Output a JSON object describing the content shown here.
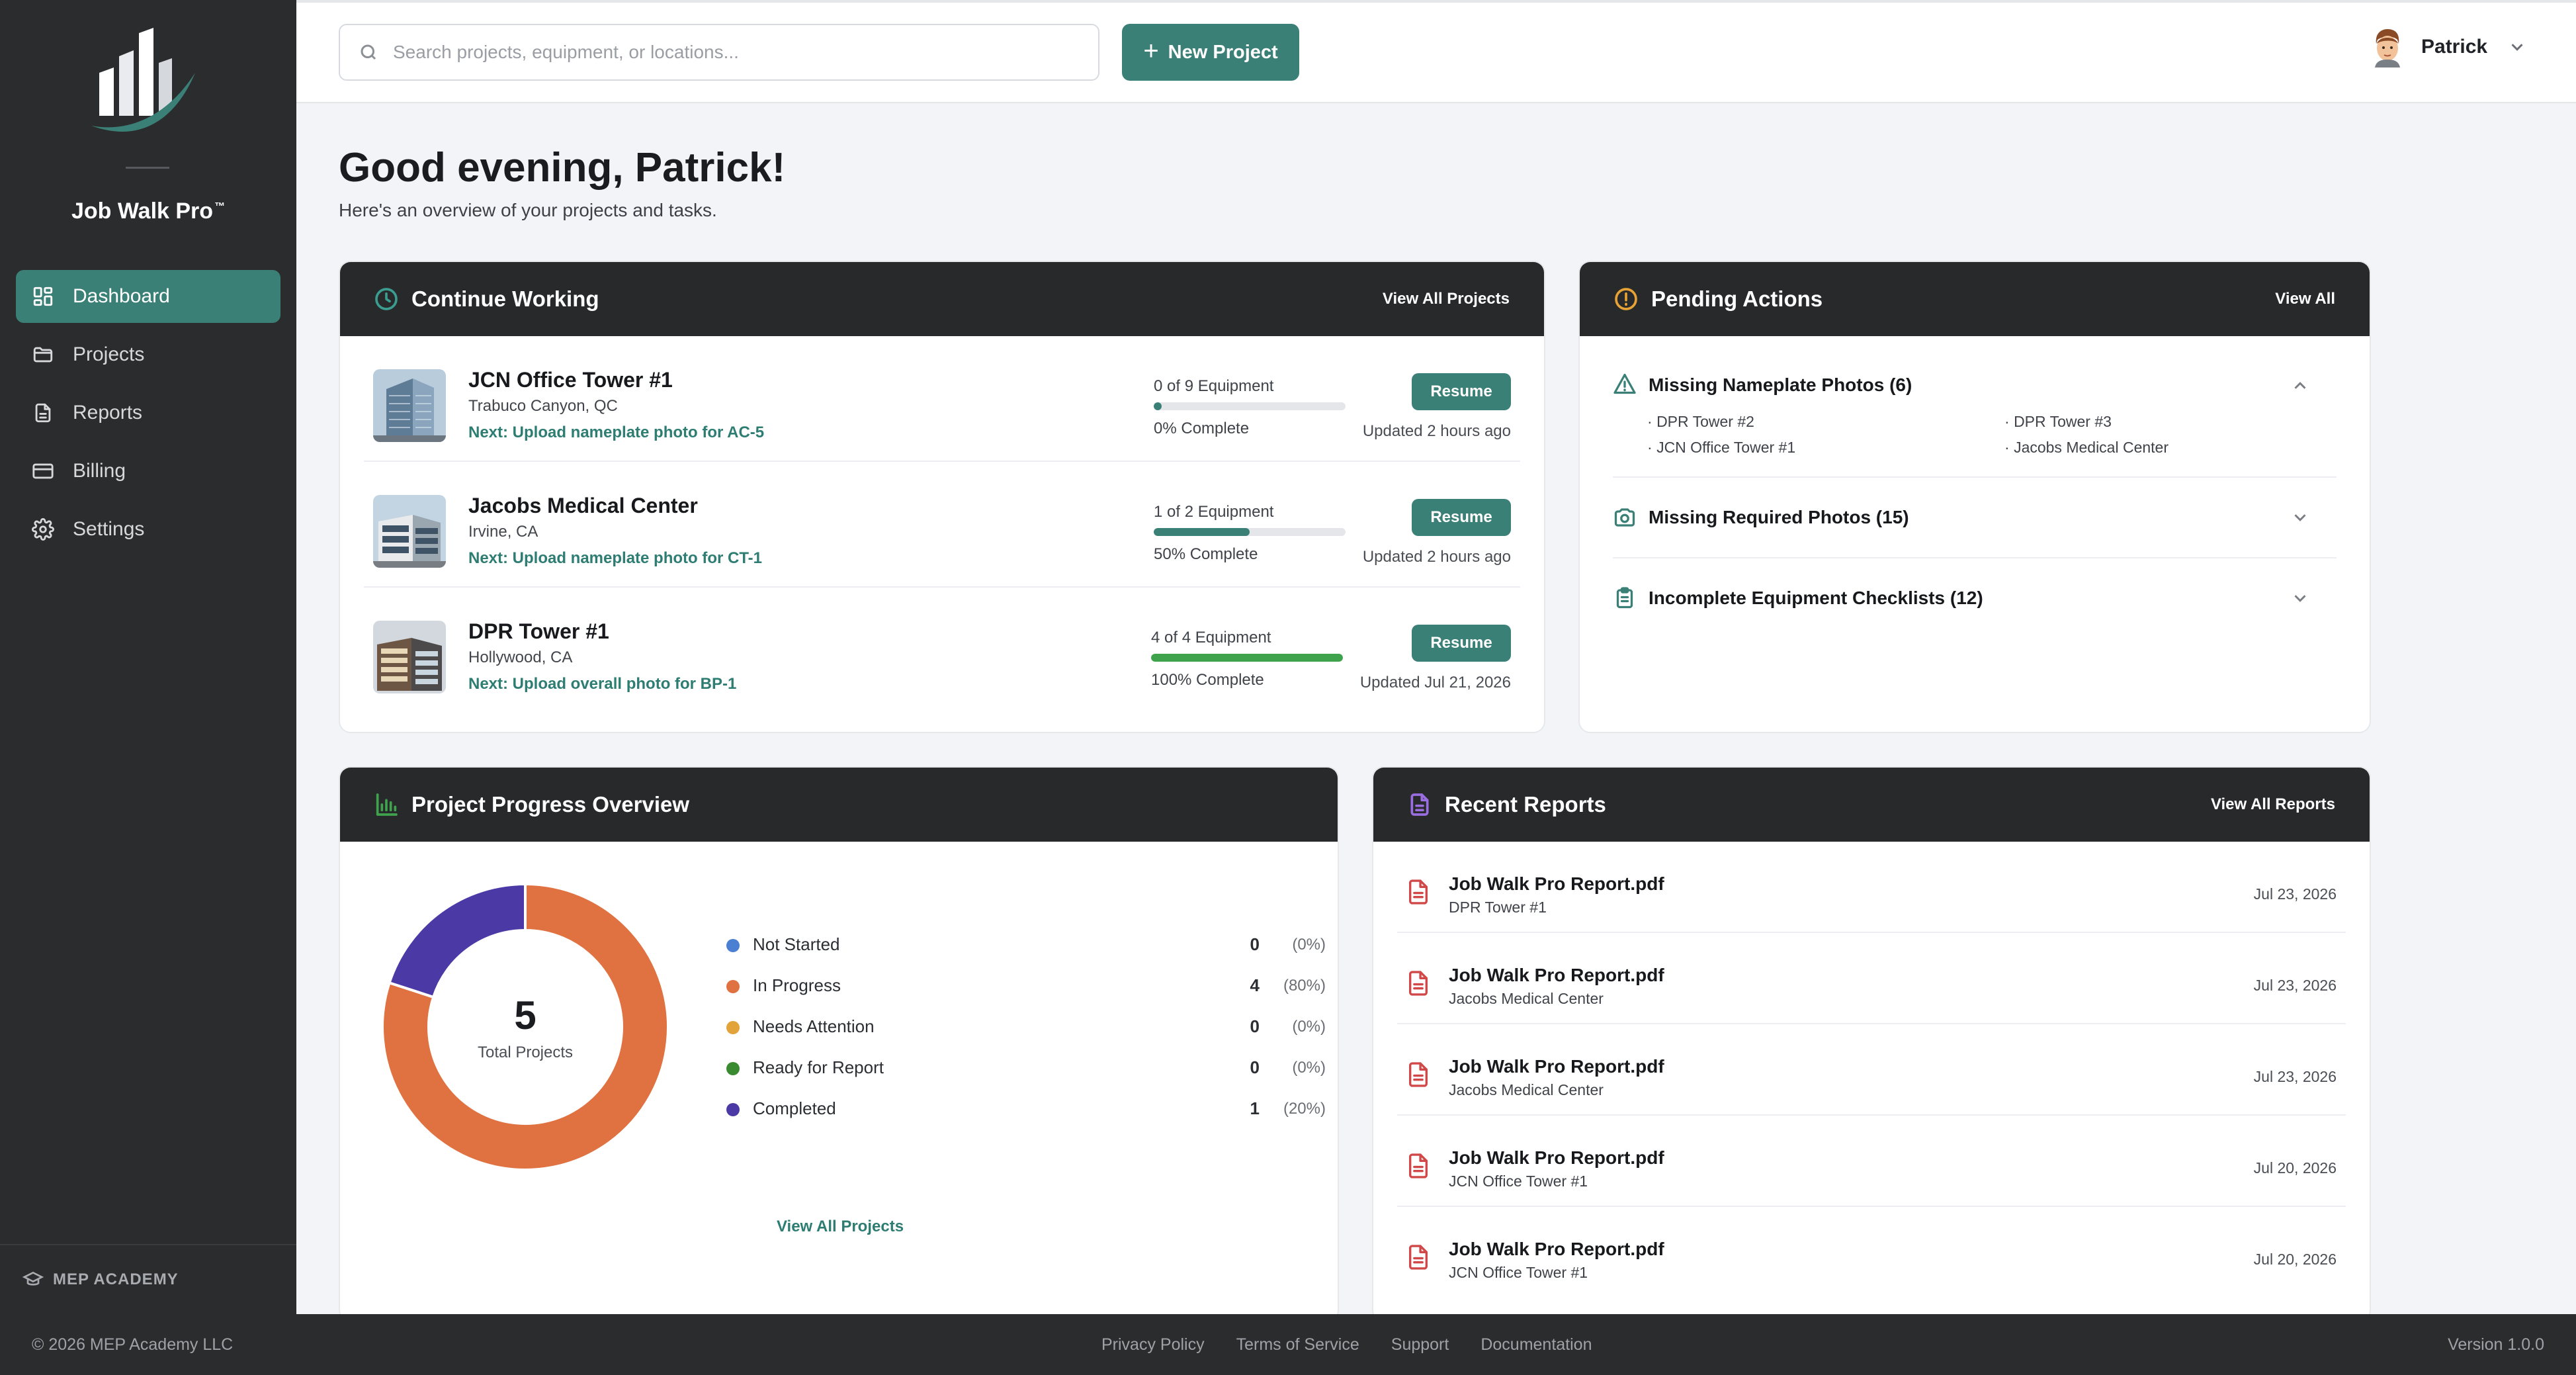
{
  "sidebar": {
    "brand": "Job Walk Pro",
    "brand_mark": "™",
    "nav": [
      {
        "label": "Dashboard",
        "icon": "dashboard-icon",
        "active": true
      },
      {
        "label": "Projects",
        "icon": "folder-icon"
      },
      {
        "label": "Reports",
        "icon": "document-icon"
      },
      {
        "label": "Billing",
        "icon": "credit-card-icon"
      },
      {
        "label": "Settings",
        "icon": "gear-icon"
      }
    ],
    "academy": "MEP ACADEMY"
  },
  "topbar": {
    "search_placeholder": "Search projects, equipment, or locations...",
    "new_project": "New Project",
    "user_name": "Patrick"
  },
  "greeting": {
    "title": "Good evening, Patrick!",
    "subtitle": "Here's an overview of your projects and tasks."
  },
  "continue_working": {
    "title": "Continue Working",
    "link": "View All Projects",
    "projects": [
      {
        "name": "JCN Office Tower #1",
        "location": "Trabuco Canyon, QC",
        "next": "Next: Upload nameplate photo for AC-5",
        "equipment": "0 of 9 Equipment",
        "progress": 0,
        "percent_label": "0% Complete",
        "button": "Resume",
        "updated": "Updated 2 hours ago"
      },
      {
        "name": "Jacobs Medical Center",
        "location": "Irvine, CA",
        "next": "Next: Upload nameplate photo for CT-1",
        "equipment": "1 of 2 Equipment",
        "progress": 50,
        "percent_label": "50% Complete",
        "button": "Resume",
        "updated": "Updated 2 hours ago"
      },
      {
        "name": "DPR Tower #1",
        "location": "Hollywood, CA",
        "next": "Next: Upload overall photo for BP-1",
        "equipment": "4 of 4 Equipment",
        "progress": 100,
        "percent_label": "100% Complete",
        "button": "Resume",
        "updated": "Updated Jul 21, 2026"
      }
    ]
  },
  "pending_actions": {
    "title": "Pending Actions",
    "link": "View All",
    "sections": [
      {
        "title": "Missing Nameplate Photos (6)",
        "icon": "warning-triangle-icon",
        "expanded": true,
        "items": [
          "DPR Tower #2",
          "DPR Tower #3",
          "JCN Office Tower #1",
          "Jacobs Medical Center"
        ]
      },
      {
        "title": "Missing Required Photos (15)",
        "icon": "camera-icon",
        "expanded": false
      },
      {
        "title": "Incomplete Equipment Checklists (12)",
        "icon": "clipboard-icon",
        "expanded": false
      }
    ]
  },
  "progress_overview": {
    "title": "Project Progress Overview",
    "total": "5",
    "total_label": "Total Projects",
    "link": "View All Projects",
    "legend": [
      {
        "label": "Not Started",
        "count": "0",
        "pct": "(0%)",
        "color": "#4a7fd1"
      },
      {
        "label": "In Progress",
        "count": "4",
        "pct": "(80%)",
        "color": "#e07140"
      },
      {
        "label": "Needs Attention",
        "count": "0",
        "pct": "(0%)",
        "color": "#e3a33b"
      },
      {
        "label": "Ready for Report",
        "count": "0",
        "pct": "(0%)",
        "color": "#3a8a32"
      },
      {
        "label": "Completed",
        "count": "1",
        "pct": "(20%)",
        "color": "#4b3aa6"
      }
    ]
  },
  "chart_data": {
    "type": "pie",
    "categories": [
      "Not Started",
      "In Progress",
      "Needs Attention",
      "Ready for Report",
      "Completed"
    ],
    "values": [
      0,
      4,
      0,
      0,
      1
    ],
    "colors": [
      "#4a7fd1",
      "#e07140",
      "#e3a33b",
      "#3a8a32",
      "#4b3aa6"
    ],
    "title": "Project Progress Overview"
  },
  "recent_reports": {
    "title": "Recent Reports",
    "link": "View All Reports",
    "reports": [
      {
        "file": "Job Walk Pro Report.pdf",
        "project": "DPR Tower #1",
        "date": "Jul 23, 2026"
      },
      {
        "file": "Job Walk Pro Report.pdf",
        "project": "Jacobs Medical Center",
        "date": "Jul 23, 2026"
      },
      {
        "file": "Job Walk Pro Report.pdf",
        "project": "Jacobs Medical Center",
        "date": "Jul 23, 2026"
      },
      {
        "file": "Job Walk Pro Report.pdf",
        "project": "JCN Office Tower #1",
        "date": "Jul 20, 2026"
      },
      {
        "file": "Job Walk Pro Report.pdf",
        "project": "JCN Office Tower #1",
        "date": "Jul 20, 2026"
      }
    ]
  },
  "footer": {
    "copyright": "© 2026 MEP Academy LLC",
    "links": [
      "Privacy Policy",
      "Terms of Service",
      "Support",
      "Documentation"
    ],
    "version": "Version 1.0.0"
  },
  "colors": {
    "accent": "#3b8077",
    "header_dark": "#28292b",
    "sidebar": "#2b2c2e",
    "pdf_red": "#d04848"
  }
}
